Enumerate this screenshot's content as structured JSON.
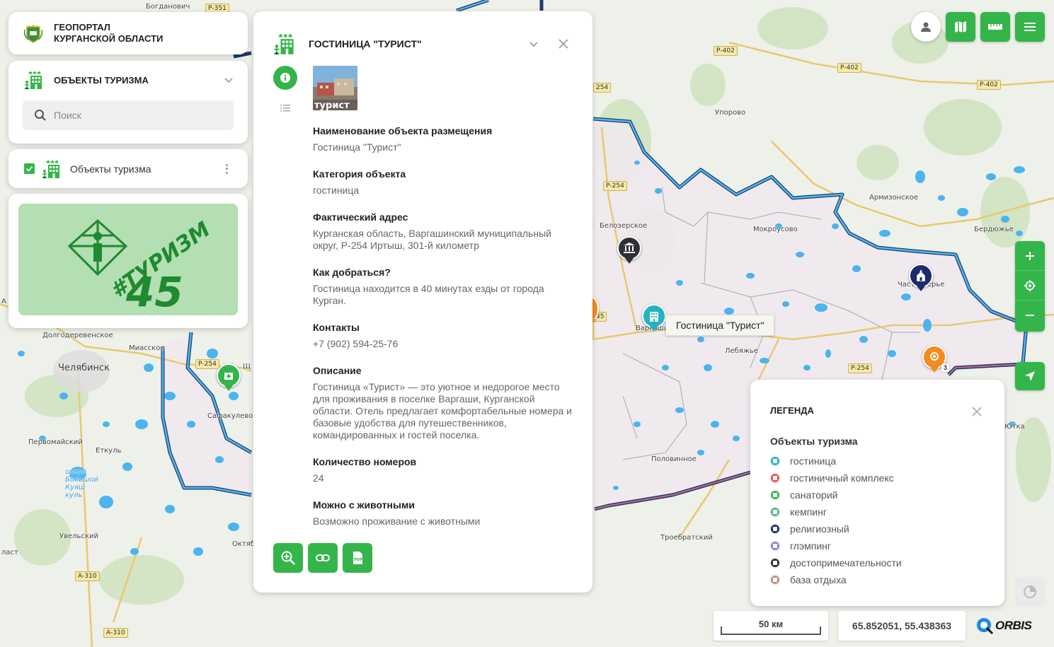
{
  "app": {
    "title_line1": "ГЕОПОРТАЛ",
    "title_line2": "КУРГАНСКОЙ ОБЛАСТИ"
  },
  "layer_panel": {
    "title": "ОБЪЕКТЫ ТУРИЗМА",
    "search_placeholder": "Поиск",
    "layer_name": "Объекты туризма",
    "layer_checked": true
  },
  "banner": {
    "line1": "#ТУРИЗМ",
    "line2": "45"
  },
  "detail": {
    "title": "ГОСТИНИЦА \"ТУРИСТ\"",
    "photo_caption": "турист",
    "fields": [
      {
        "label": "Наименование объекта размещения",
        "value": "Гостиница \"Турист\""
      },
      {
        "label": "Категория объекта",
        "value": "гостиница"
      },
      {
        "label": "Фактический адрес",
        "value": "Курганская область, Варгашинский муниципальный округ, Р-254 Иртыш, 301-й километр"
      },
      {
        "label": "Как добраться?",
        "value": "Гостиница находится в 40 минутах езды от города Курган."
      },
      {
        "label": "Контакты",
        "value": "+7 (902) 594-25-76"
      },
      {
        "label": "Описание",
        "value": "Гостиница «Турист» — это уютное и недорогое место для проживания в поселке Варгаши, Курганской области. Отель предлагает комфортабельные номера и базовые удобства для путешественников, командированных и гостей поселка."
      },
      {
        "label": "Количество номеров",
        "value": "24"
      },
      {
        "label": "Можно с животными",
        "value": "Возможно проживание с животными"
      }
    ]
  },
  "map": {
    "tooltip": "Гостиница \"Турист\"",
    "places": [
      {
        "name": "Богданович"
      },
      {
        "name": "Упорово"
      },
      {
        "name": "Армизонское"
      },
      {
        "name": "Бердюжье"
      },
      {
        "name": "Белозерское"
      },
      {
        "name": "Мокроусово"
      },
      {
        "name": "Частоозерье"
      },
      {
        "name": "Варгаши"
      },
      {
        "name": "Лебяжье"
      },
      {
        "name": "Долгодеревенское"
      },
      {
        "name": "Миасское"
      },
      {
        "name": "Челябинск"
      },
      {
        "name": "Щ"
      },
      {
        "name": "Сафакулево"
      },
      {
        "name": "Первомайский"
      },
      {
        "name": "Еткуль"
      },
      {
        "name": "Увельский"
      },
      {
        "name": "Октяб"
      },
      {
        "name": "Половинное"
      },
      {
        "name": "Троебратский"
      },
      {
        "name": "ласт"
      },
      {
        "name": "Ютка"
      },
      {
        "name": "А"
      }
    ],
    "lake_label": "озеро\nБольшой\nКуяш\nкуль",
    "roads": [
      "Р-351",
      "Р-402",
      "Р-402",
      "Р-402",
      "254",
      "Р-254",
      "Р-254",
      "Р-254",
      "45",
      "А-310",
      "А-310"
    ],
    "cluster_count": "3"
  },
  "legend": {
    "title": "ЛЕГЕНДА",
    "subtitle": "Объекты туризма",
    "items": [
      {
        "label": "гостиница",
        "color": "#20b3c4"
      },
      {
        "label": "гостиничный комплекс",
        "color": "#e4574f"
      },
      {
        "label": "санаторий",
        "color": "#34b54a"
      },
      {
        "label": "кемпинг",
        "color": "#5fae8c"
      },
      {
        "label": "религиозный",
        "color": "#1d2a6b"
      },
      {
        "label": "глэмпинг",
        "color": "#8b83c9"
      },
      {
        "label": "достопримечательности",
        "color": "#2f3033"
      },
      {
        "label": "база отдыха",
        "color": "#b89585"
      }
    ]
  },
  "scale": {
    "label": "50 км"
  },
  "coordinates": "65.852051, 55.438363",
  "logo": {
    "text": "ORBIS"
  },
  "colors": {
    "accent": "#34b54a",
    "region_border": "#1f7fc7",
    "hotel": "#20b3c4",
    "religious": "#1d2a6b",
    "sight": "#2f3033",
    "cluster": "#f28c1e"
  }
}
